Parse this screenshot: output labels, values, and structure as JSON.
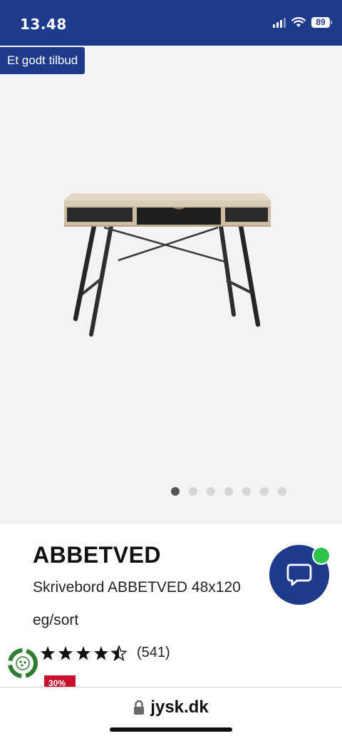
{
  "status_bar": {
    "time": "13.48",
    "battery": "89"
  },
  "gallery": {
    "badge": "Et godt tilbud",
    "image_icon": "desk-product-image",
    "pagination": {
      "total": 7,
      "active": 1
    }
  },
  "product": {
    "brand": "ABBETVED",
    "name": "Skrivebord ABBETVED 48x120",
    "variant": "eg/sort",
    "rating": 4.5,
    "rating_count": "(541)",
    "sale_tag": "30%"
  },
  "chat": {
    "icon": "chat-bubble-icon",
    "status_color": "#2bc34a"
  },
  "browser": {
    "url": "jysk.dk"
  },
  "colors": {
    "brand_blue": "#1e3a8a",
    "sale_red": "#c8102e",
    "eco_green": "#2e7d32"
  }
}
